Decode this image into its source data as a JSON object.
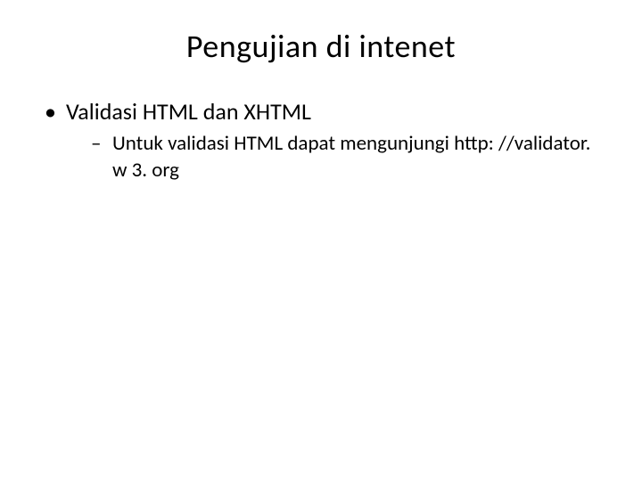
{
  "slide": {
    "title": "Pengujian di intenet",
    "bullets": [
      {
        "text": "Validasi HTML dan XHTML",
        "sub": [
          {
            "text": "Untuk validasi HTML dapat mengunjungi http: //validator. w 3. org"
          }
        ]
      }
    ]
  }
}
